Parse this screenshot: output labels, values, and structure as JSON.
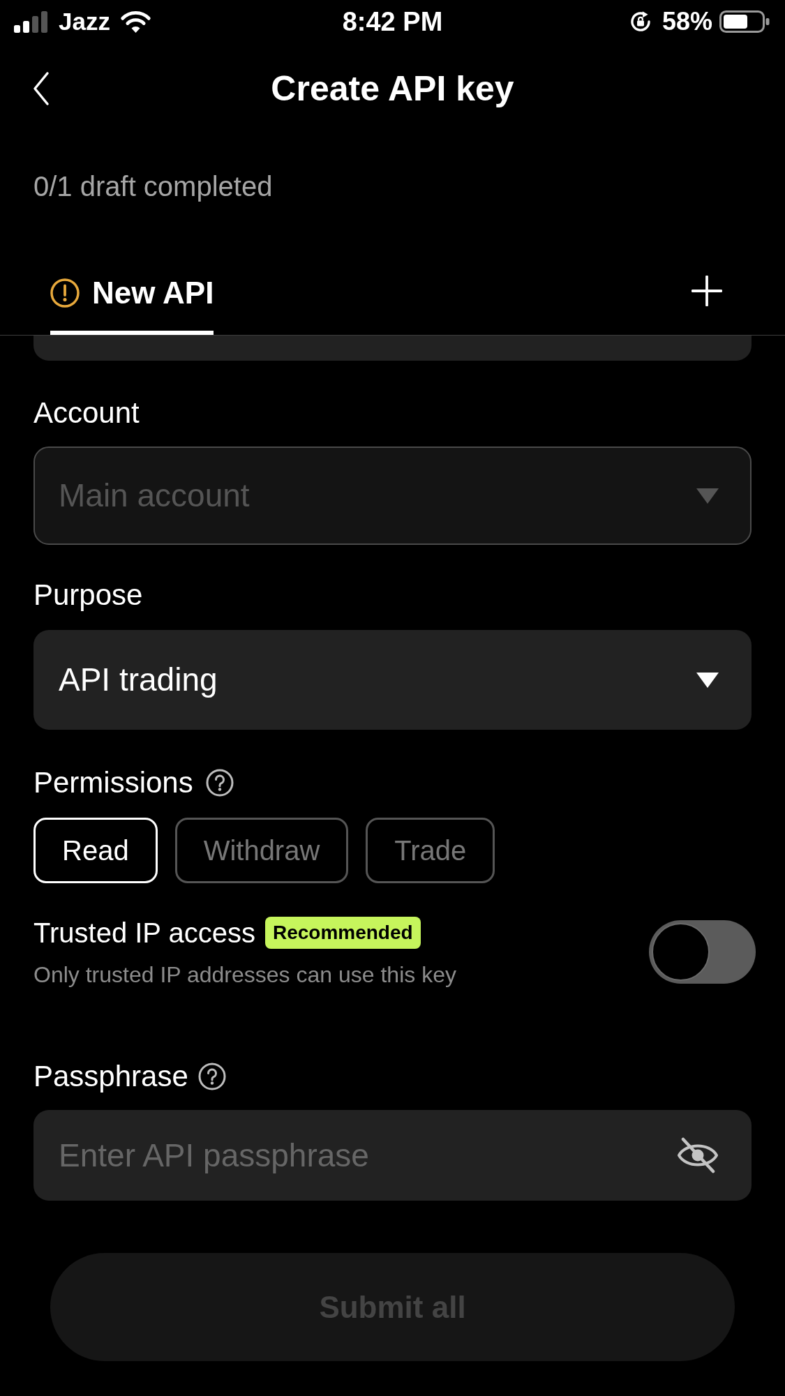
{
  "status_bar": {
    "carrier": "Jazz",
    "time": "8:42 PM",
    "battery": "58%"
  },
  "header": {
    "title": "Create API key"
  },
  "drafts_note": "0/1 draft completed",
  "tabs": [
    {
      "label": "New API",
      "selected": true,
      "completed": false
    }
  ],
  "form": {
    "account": {
      "label": "Account",
      "value": "Main account",
      "disabled": true
    },
    "purpose": {
      "label": "Purpose",
      "value": "API trading",
      "disabled": false
    },
    "permissions": {
      "label": "Permissions",
      "options": [
        {
          "label": "Read",
          "selected": true
        },
        {
          "label": "Withdraw",
          "selected": false
        },
        {
          "label": "Trade",
          "selected": false
        }
      ]
    },
    "trusted_ip": {
      "label": "Trusted IP access",
      "badge": "Recommended",
      "description": "Only trusted IP addresses can use this key",
      "on": false
    },
    "passphrase": {
      "label": "Passphrase",
      "placeholder": "Enter API passphrase"
    }
  },
  "submit": {
    "label": "Submit all",
    "disabled": true
  }
}
